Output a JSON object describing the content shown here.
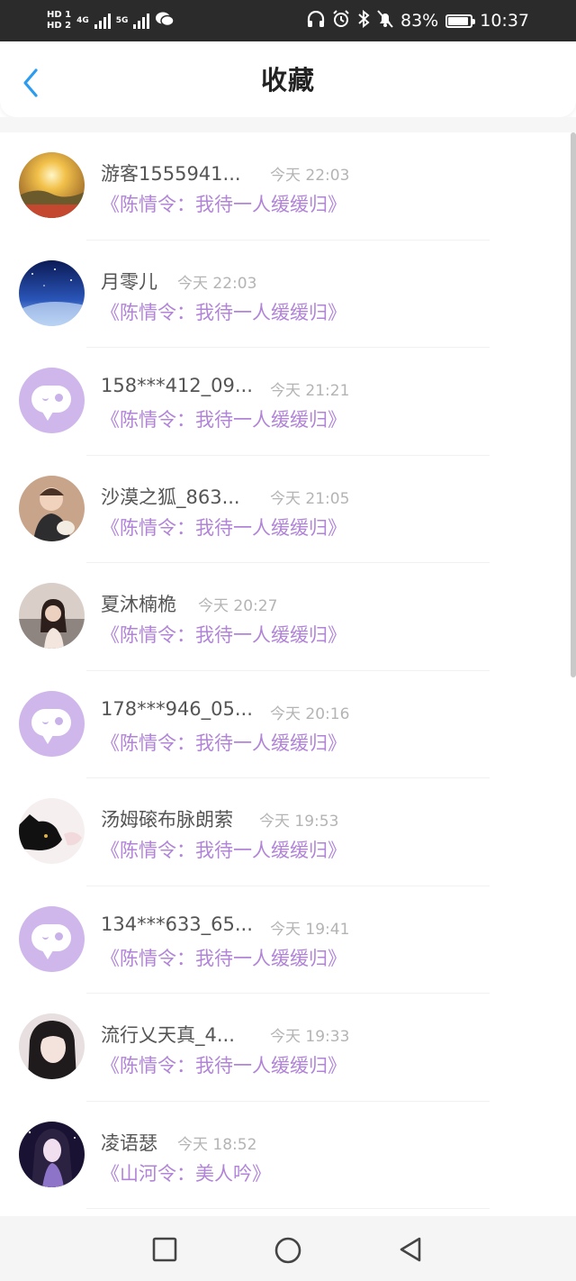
{
  "status_bar": {
    "hd1": "HD 1",
    "hd2": "HD 2",
    "net1": "4G",
    "net2": "5G",
    "battery": "83%",
    "time": "10:37",
    "icons": [
      "headphones-icon",
      "alarm-icon",
      "bluetooth-icon",
      "mute-bell-icon",
      "battery-icon",
      "wechat-icon"
    ]
  },
  "header": {
    "title": "收藏",
    "back_icon": "chevron-left-icon",
    "accent_color": "#2b9cf0"
  },
  "items": [
    {
      "name": "游客1555941...",
      "time": "今天 22:03",
      "book": "《陈情令：我待一人缓缓归》",
      "avatar": "sunset-photo"
    },
    {
      "name": "月零儿",
      "time": "今天 22:03",
      "book": "《陈情令：我待一人缓缓归》",
      "avatar": "night-sky-photo"
    },
    {
      "name": "158***412_09...",
      "time": "今天 21:21",
      "book": "《陈情令：我待一人缓缓归》",
      "avatar": "default-bubble"
    },
    {
      "name": "沙漠之狐_863...",
      "time": "今天 21:05",
      "book": "《陈情令：我待一人缓缓归》",
      "avatar": "child-photo"
    },
    {
      "name": "夏沐楠桅",
      "time": "今天 20:27",
      "book": "《陈情令：我待一人缓缓归》",
      "avatar": "girl-photo"
    },
    {
      "name": "178***946_05...",
      "time": "今天 20:16",
      "book": "《陈情令：我待一人缓缓归》",
      "avatar": "default-bubble"
    },
    {
      "name": "汤姆磙布脉朗萦",
      "time": "今天 19:53",
      "book": "《陈情令：我待一人缓缓归》",
      "avatar": "black-cat-photo"
    },
    {
      "name": "134***633_65...",
      "time": "今天 19:41",
      "book": "《陈情令：我待一人缓缓归》",
      "avatar": "default-bubble"
    },
    {
      "name": "流行乂天真_4...",
      "time": "今天 19:33",
      "book": "《陈情令：我待一人缓缓归》",
      "avatar": "portrait-photo"
    },
    {
      "name": "凌语瑟",
      "time": "今天 18:52",
      "book": "《山河令：美人吟》",
      "avatar": "anime-photo"
    }
  ],
  "colors": {
    "book_title": "#b184d8",
    "default_avatar_bg": "#cfb7ec"
  },
  "nav_bar": {
    "buttons": [
      "recent-apps-square-icon",
      "home-circle-icon",
      "back-triangle-icon"
    ]
  }
}
